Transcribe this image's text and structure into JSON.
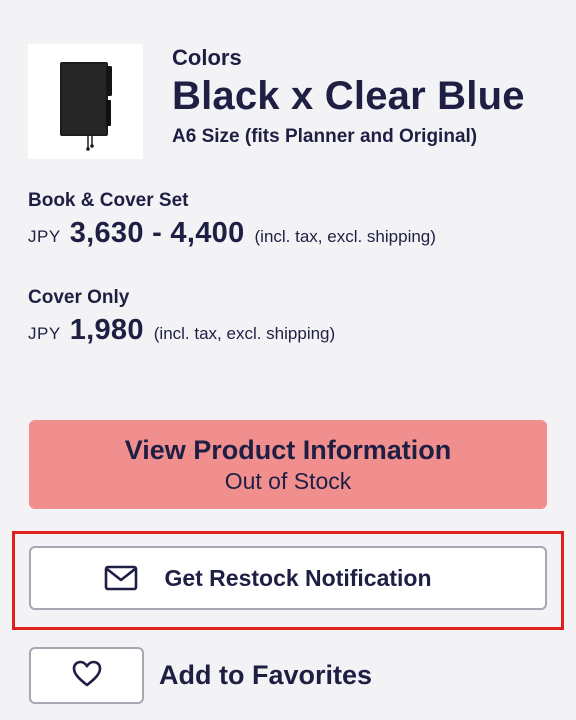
{
  "product": {
    "colors_label": "Colors",
    "color_name": "Black x Clear Blue",
    "size_note": "A6 Size (fits Planner and Original)",
    "thumbnail_icon": "notebook-cover-image"
  },
  "prices": {
    "book_cover_set": {
      "title": "Book & Cover Set",
      "currency": "JPY",
      "amount": "3,630 - 4,400",
      "tax_note": "(incl. tax, excl. shipping)"
    },
    "cover_only": {
      "title": "Cover Only",
      "currency": "JPY",
      "amount": "1,980",
      "tax_note": "(incl. tax, excl. shipping)"
    }
  },
  "actions": {
    "view_product": {
      "title": "View Product Information",
      "status": "Out of Stock",
      "color": "#f18f8f"
    },
    "restock": {
      "label": "Get Restock Notification",
      "icon": "mail-icon"
    },
    "favorites": {
      "label": "Add to Favorites",
      "icon": "heart-icon"
    }
  },
  "colors": {
    "text": "#1f1f44",
    "background": "#f3f3f6",
    "highlight": "#e02020",
    "button_border": "#a7a7b3"
  }
}
